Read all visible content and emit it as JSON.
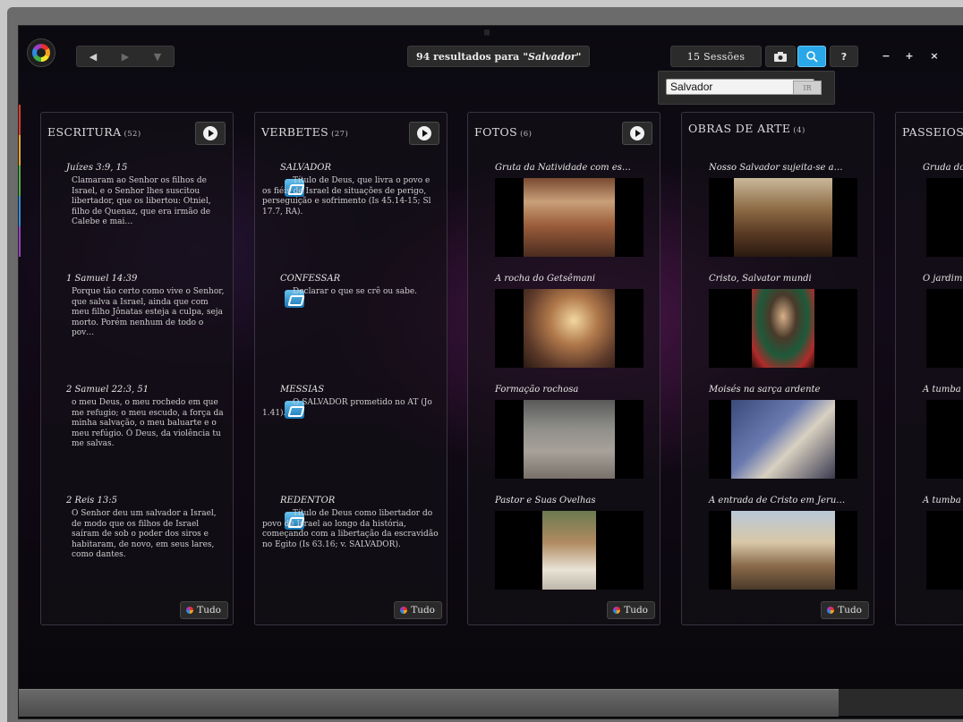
{
  "toolbar": {
    "back": "◀",
    "forward": "▶",
    "dropdown": "▼",
    "results_count": "94 resultados para",
    "results_query": "\"Salvador\"",
    "sessions": "15 Sessões",
    "help": "?",
    "minus": "−",
    "plus": "+",
    "close": "×"
  },
  "search": {
    "value": "Salvador",
    "go": "IR"
  },
  "columns": [
    {
      "title": "ESCRITURA",
      "count": "(52)"
    },
    {
      "title": "VERBETES",
      "count": "(27)"
    },
    {
      "title": "FOTOS",
      "count": "(6)"
    },
    {
      "title": "OBRAS DE ARTE",
      "count": "(4)"
    },
    {
      "title": "PASSEIOS",
      "count": ""
    }
  ],
  "scripture": [
    {
      "ref": "Juízes 3:9, 15",
      "text": "Clamaram ao Senhor os filhos de Israel, e o Senhor lhes suscitou libertador, que os libertou: Otniel, filho de Quenaz, que era irmão de Calebe e mai…"
    },
    {
      "ref": "1 Samuel 14:39",
      "text": "Porque tão certo como vive o Senhor, que salva a Israel, ainda que com meu filho Jônatas esteja a culpa, seja morto. Porém nenhum de todo o pov…"
    },
    {
      "ref": "2 Samuel 22:3, 51",
      "text": "o meu Deus, o meu rochedo em que me refugio; o meu escudo, a força da minha salvação, o meu baluarte e o meu refúgio. Ó Deus, da violência tu me salvas."
    },
    {
      "ref": "2 Reis 13:5",
      "text": "O Senhor deu um salvador a Israel, de modo que os filhos de Israel saíram de sob o poder dos siros e habitaram, de novo, em seus lares, como dantes."
    }
  ],
  "verbetes": [
    {
      "term": "SALVADOR",
      "text": "Título de Deus, que livra o povo e os fiéis de Israel de situações de perigo, perseguição e sofrimento (Is 45.14-15; Sl 17.7, RA)."
    },
    {
      "term": "CONFESSAR",
      "text": "Declarar o que se crê ou sabe."
    },
    {
      "term": "MESSIAS",
      "text": "O SALVADOR prometido no AT (Jo 1.41)."
    },
    {
      "term": "REDENTOR",
      "text": "Título de Deus como libertador do povo de Israel ao longo da história, começando com a libertação da escravidão no Egito (Is 63.16; v. SALVADOR)."
    }
  ],
  "fotos": [
    {
      "title": "Gruta da Natividade com es…",
      "pic": "cave-shrine"
    },
    {
      "title": "A rocha do Getsêmani",
      "pic": "church-rock"
    },
    {
      "title": "Formação rochosa",
      "pic": "rock-formation"
    },
    {
      "title": "Pastor e Suas Ovelhas",
      "pic": "shepherd"
    }
  ],
  "obras": [
    {
      "title": "Nosso Salvador sujeita-se a…",
      "pic": "workshop"
    },
    {
      "title": "Cristo, Salvator mundi",
      "pic": "christ"
    },
    {
      "title": "Moisés na sarça ardente",
      "pic": "moses"
    },
    {
      "title": "A entrada de Cristo em Jeru…",
      "pic": "entry"
    }
  ],
  "passeios": [
    {
      "title": "Gruda do"
    },
    {
      "title": "O jardim"
    },
    {
      "title": "A tumba"
    },
    {
      "title": "A tumba"
    }
  ],
  "all_label": "Tudo"
}
